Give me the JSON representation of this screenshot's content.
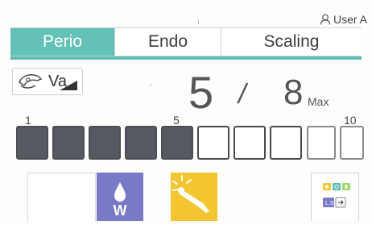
{
  "user": {
    "label": "User A",
    "icon": "user-icon"
  },
  "tabs": [
    {
      "label": "Perio",
      "active": true
    },
    {
      "label": "Endo",
      "active": false
    },
    {
      "label": "Scaling",
      "active": false
    }
  ],
  "mode": {
    "label": "Va",
    "icon": "handpiece-icon",
    "ramp_icon": "ramp-icon"
  },
  "power": {
    "current": "5",
    "separator": "/",
    "max": "8",
    "max_label": "Max"
  },
  "level_scale": {
    "labels": [
      "1",
      "5",
      "10"
    ],
    "filled": 5,
    "total": 10
  },
  "bottom": {
    "water_label": "W",
    "water_icon": "water-drop-icon",
    "light_icon": "light-icon",
    "settings_icon": "settings-grid-icon"
  },
  "colors": {
    "accent": "#63c1b8",
    "water": "#7a79c7",
    "light": "#f2c531",
    "bar_filled": "#56595f"
  }
}
